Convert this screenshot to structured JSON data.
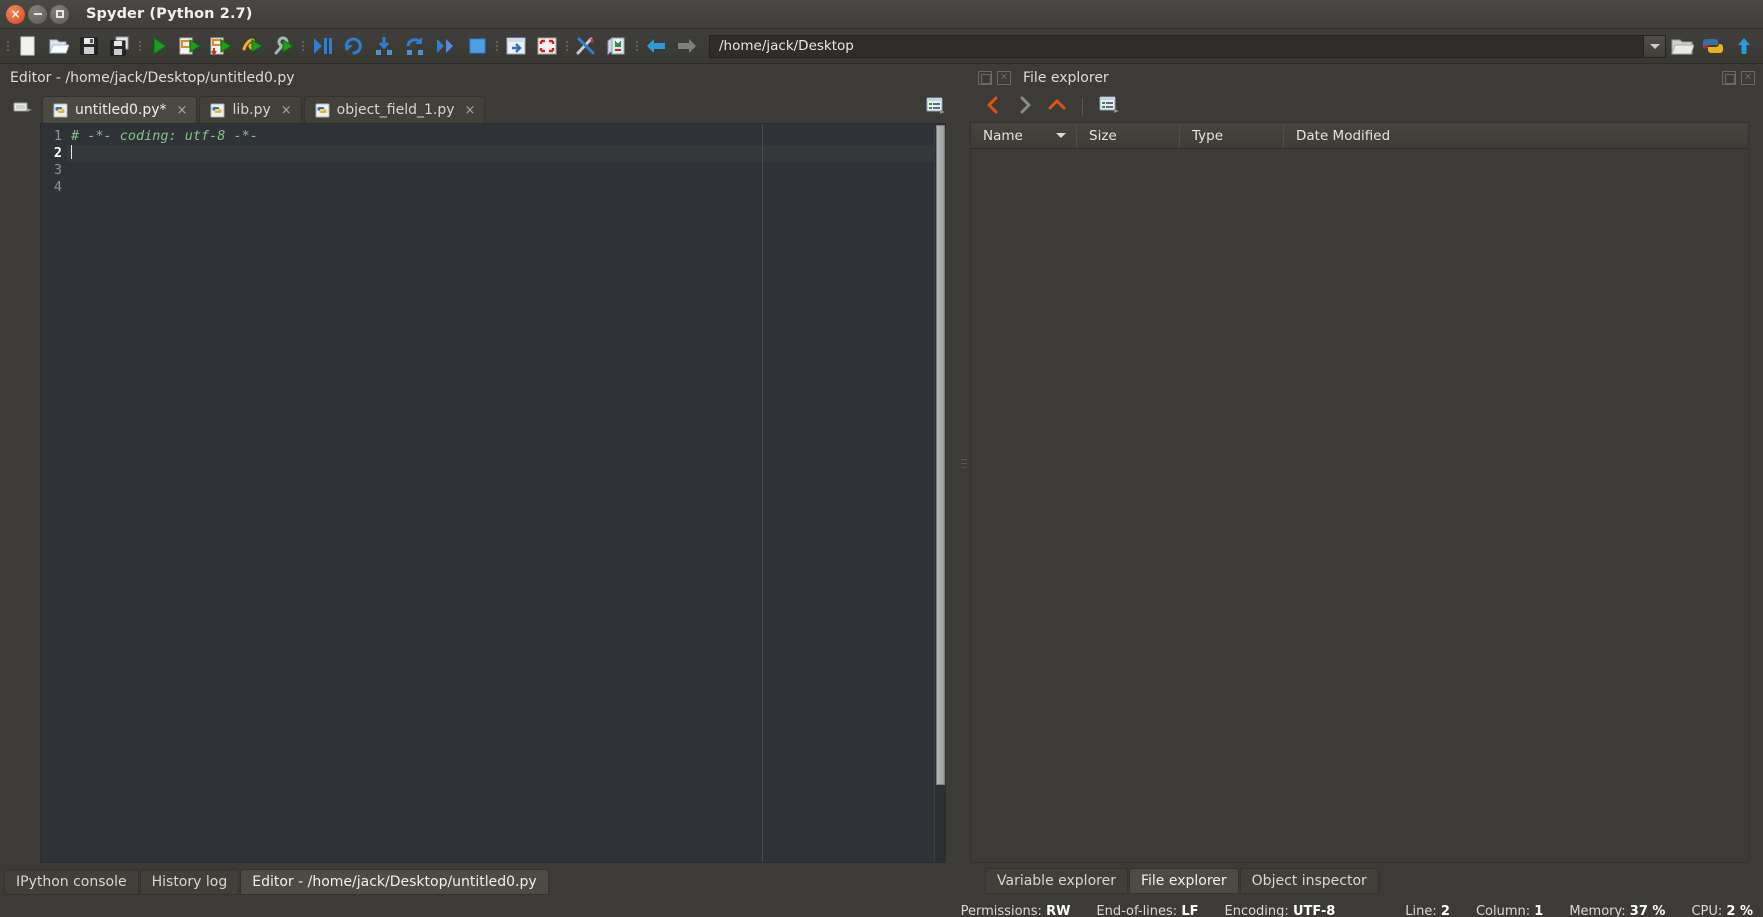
{
  "window": {
    "title": "Spyder (Python 2.7)",
    "controls": [
      {
        "name": "close-button",
        "glyph": "×"
      },
      {
        "name": "minimize-button",
        "glyph": "−"
      },
      {
        "name": "maximize-button",
        "glyph": "□"
      }
    ]
  },
  "toolbar": {
    "icons": [
      "new-file-icon",
      "open-file-icon",
      "save-file-icon",
      "save-all-icon",
      "run-file-icon",
      "run-cell-icon",
      "run-cell-advance-icon",
      "run-selection-icon",
      "configure-run-icon",
      "debug-file-icon",
      "debug-continue-icon",
      "debug-step-into-icon",
      "debug-step-over-icon",
      "debug-step-return-icon",
      "debug-exit-icon",
      "maximize-pane-icon",
      "fullscreen-icon",
      "preferences-icon",
      "pythonpath-manager-icon",
      "back-arrow-icon",
      "forward-arrow-icon"
    ],
    "path_value": "/home/jack/Desktop",
    "right_icons": [
      "browse-folder-icon",
      "python-interpreter-icon",
      "parent-dir-icon"
    ]
  },
  "editor_pane": {
    "title": "Editor - /home/jack/Desktop/untitled0.py",
    "options_icon": "editor-options-icon",
    "browse-tabs-icon": "browse-tabs-icon",
    "tabs": [
      {
        "label": "untitled0.py*",
        "active": true,
        "close": "×",
        "icon": "python-file-icon"
      },
      {
        "label": "lib.py",
        "active": false,
        "close": "×",
        "icon": "python-file-icon"
      },
      {
        "label": "object_field_1.py",
        "active": false,
        "close": "×",
        "icon": "python-file-icon"
      }
    ],
    "line_numbers": [
      "1",
      "2",
      "3",
      "4"
    ],
    "current_line_index": 1,
    "code_lines": [
      {
        "text": "# -*- coding: utf-8 -*-",
        "kind": "comment"
      },
      {
        "text": "",
        "kind": "plain"
      },
      {
        "text": "",
        "kind": "plain"
      },
      {
        "text": "",
        "kind": "plain"
      }
    ]
  },
  "file_explorer": {
    "title": "File explorer",
    "panel_icons": [
      "undock-icon",
      "close-pane-icon"
    ],
    "nav_icons": [
      "back-icon",
      "forward-icon",
      "parent-directory-icon",
      "explorer-options-icon"
    ],
    "columns": [
      {
        "label": "Name",
        "sorted": true
      },
      {
        "label": "Size",
        "sorted": false
      },
      {
        "label": "Type",
        "sorted": false
      },
      {
        "label": "Date Modified",
        "sorted": false
      }
    ],
    "rows": []
  },
  "bottom_tabs_left": [
    {
      "label": "IPython console",
      "active": false
    },
    {
      "label": "History log",
      "active": false
    },
    {
      "label": "Editor - /home/jack/Desktop/untitled0.py",
      "active": true
    }
  ],
  "bottom_tabs_right": [
    {
      "label": "Variable explorer",
      "active": false
    },
    {
      "label": "File explorer",
      "active": true
    },
    {
      "label": "Object inspector",
      "active": false
    }
  ],
  "statusbar": [
    {
      "label": "Permissions:",
      "value": "RW"
    },
    {
      "label": "End-of-lines:",
      "value": "LF"
    },
    {
      "label": "Encoding:",
      "value": "UTF-8"
    },
    {
      "label": "Line:",
      "value": "2"
    },
    {
      "label": "Column:",
      "value": "1"
    },
    {
      "label": "Memory:",
      "value": "37 %"
    },
    {
      "label": "CPU:",
      "value": "2 %"
    }
  ],
  "colors": {
    "chrome": "#3c3b37",
    "editor_bg": "#2f3337",
    "comment_green": "#86c08a",
    "accent_orange": "#dd4814",
    "run_green": "#2aa02a",
    "debug_blue": "#2e7fd4"
  }
}
